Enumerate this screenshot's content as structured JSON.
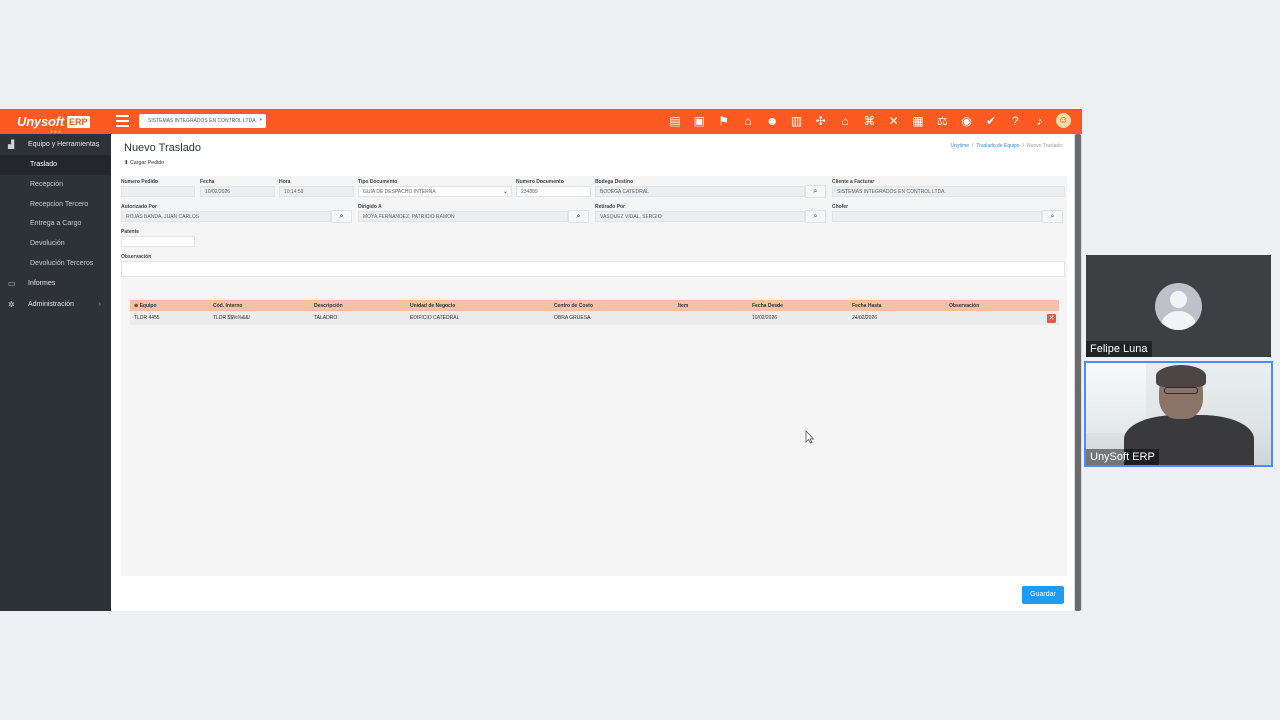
{
  "app": {
    "brand": "Unysoft",
    "brand_suffix": "ERP",
    "company_selector": "SISTEMAS INTEGRADOS EN CONTROL LTDA.",
    "top_icons": [
      "list-icon",
      "document-icon",
      "tag-icon",
      "building-icon",
      "person-icon",
      "chart-icon",
      "network-icon",
      "home-icon",
      "warehouse-icon",
      "tools-icon",
      "truck-icon",
      "scale-icon",
      "database-icon",
      "check-icon",
      "help-icon",
      "bell-icon",
      "user-avatar-icon"
    ]
  },
  "sidebar": {
    "section_equipo": "Equipo y Herramientas",
    "items": [
      {
        "label": "Traslado",
        "active": true
      },
      {
        "label": "Recepción",
        "active": false
      },
      {
        "label": "Recepcion Tercero",
        "active": false
      },
      {
        "label": "Entrega a Cargo",
        "active": false
      },
      {
        "label": "Devolución",
        "active": false
      },
      {
        "label": "Devolución Terceros",
        "active": false
      }
    ],
    "section_informes": "Informes",
    "section_admin": "Administración"
  },
  "page": {
    "title": "Nuevo Traslado",
    "cargar_label": "Cargar Pedido",
    "breadcrumb": [
      "Unytime",
      "Traslado de Equipo",
      "Nuevo Traslado"
    ]
  },
  "form": {
    "numero_pedido": {
      "label": "Numero Pedido",
      "value": ""
    },
    "fecha": {
      "label": "Fecha",
      "value": "10/02/2026"
    },
    "hora": {
      "label": "Hora",
      "value": "10:14:59"
    },
    "tipo_documento": {
      "label": "Tipo Documento",
      "value": "GUIA DE DESPACHO INTERNA"
    },
    "numero_documento": {
      "label": "Numero Documento",
      "value": "234889"
    },
    "bodega_destino": {
      "label": "Bodega Destino",
      "value": "BODEGA CATEDRAL"
    },
    "cliente_facturar": {
      "label": "Cliente a Facturar",
      "value": "SISTEMAS INTEGRADOS EN CONTROL LTDA."
    },
    "autorizado_por": {
      "label": "Autorizado Por",
      "value": "ROJAS BANDA, JUAN CARLOS"
    },
    "dirigido_a": {
      "label": "Dirigido A",
      "value": "MOYA FERNANDEZ, PATRICIO RAMON"
    },
    "retirado_por": {
      "label": "Retirado Por",
      "value": "VASQUEZ VIDAL, SERGIO"
    },
    "chofer": {
      "label": "Chofer",
      "value": ""
    },
    "patente": {
      "label": "Patente",
      "value": ""
    },
    "observacion": {
      "label": "Observación",
      "value": ""
    }
  },
  "grid": {
    "headers": [
      "⊕ Equipo",
      "Cód. Interno",
      "Descripción",
      "Unidad de Negocio",
      "Centro de Costo",
      "Ítem",
      "Fecha Desde",
      "Fecha Hasta",
      "Observación"
    ],
    "rows": [
      [
        "TLDR 4455",
        "TLDR $$%%&&/",
        "TALADRO",
        "EDIFICIO CATEDRAL",
        "OBRA GRUESA",
        "",
        "10/02/2026",
        "24/02/2026",
        ""
      ]
    ]
  },
  "actions": {
    "guardar": "Guardar"
  },
  "video": {
    "participant_1": "Felipe Luna",
    "participant_2": "UnySoft ERP"
  }
}
